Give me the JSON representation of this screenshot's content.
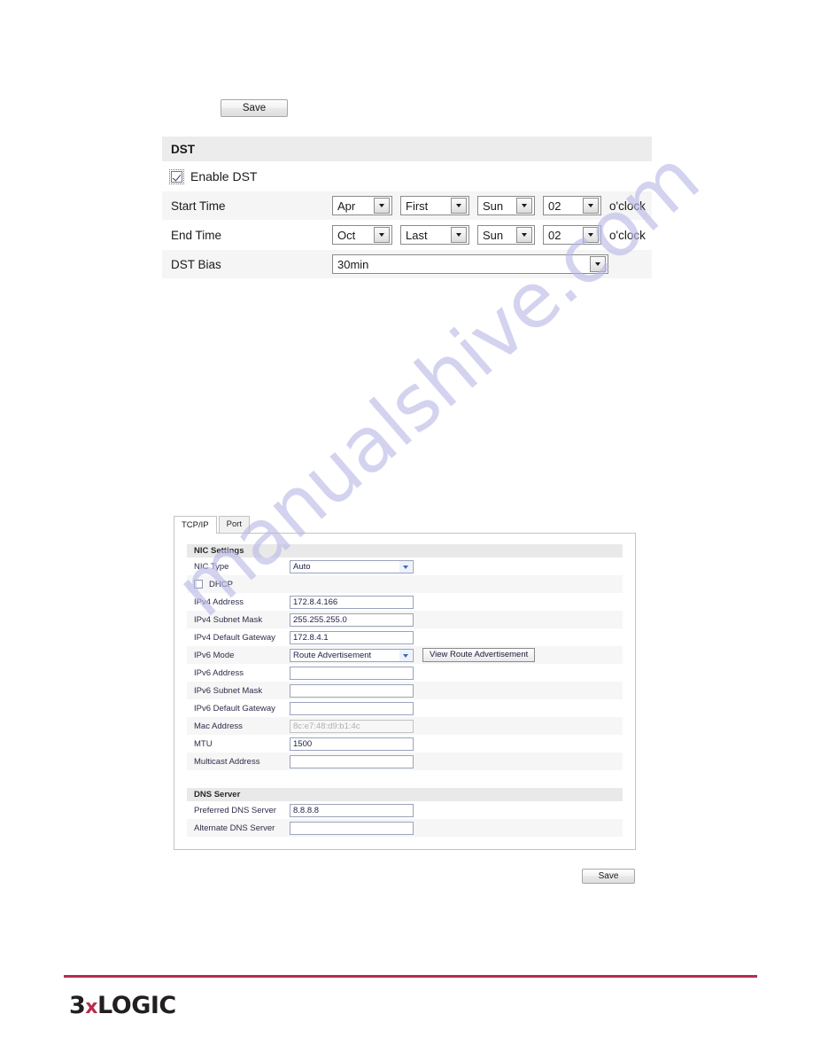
{
  "watermark": {
    "text": "manualshive.com",
    "color": "#b9b9e8"
  },
  "top_toolbar": {
    "save_label": "Save"
  },
  "dst": {
    "header": "DST",
    "enable": {
      "label": "Enable DST",
      "checked": true
    },
    "start_time": {
      "label": "Start Time",
      "month": "Apr",
      "week": "First",
      "day": "Sun",
      "hour": "02",
      "suffix": "o'clock"
    },
    "end_time": {
      "label": "End Time",
      "month": "Oct",
      "week": "Last",
      "day": "Sun",
      "hour": "02",
      "suffix": "o'clock"
    },
    "bias": {
      "label": "DST Bias",
      "value": "30min"
    }
  },
  "tcpip_panel": {
    "tabs": [
      {
        "label": "TCP/IP",
        "active": true
      },
      {
        "label": "Port",
        "active": false
      }
    ],
    "nic_settings": {
      "header": "NIC Settings",
      "nic_type": {
        "label": "NIC Type",
        "value": "Auto"
      },
      "dhcp": {
        "label": "DHCP",
        "checked": false
      },
      "ipv4_address": {
        "label": "IPv4 Address",
        "value": "172.8.4.166"
      },
      "ipv4_subnet_mask": {
        "label": "IPv4 Subnet Mask",
        "value": "255.255.255.0"
      },
      "ipv4_default_gateway": {
        "label": "IPv4 Default Gateway",
        "value": "172.8.4.1"
      },
      "ipv6_mode": {
        "label": "IPv6 Mode",
        "value": "Route Advertisement",
        "button": "View Route Advertisement"
      },
      "ipv6_address": {
        "label": "IPv6 Address",
        "value": ""
      },
      "ipv6_subnet_mask": {
        "label": "IPv6 Subnet Mask",
        "value": ""
      },
      "ipv6_default_gateway": {
        "label": "IPv6 Default Gateway",
        "value": ""
      },
      "mac_address": {
        "label": "Mac Address",
        "value": "8c:e7:48:d9:b1:4c",
        "disabled": true
      },
      "mtu": {
        "label": "MTU",
        "value": "1500"
      },
      "multicast_address": {
        "label": "Multicast Address",
        "value": ""
      }
    },
    "dns_server": {
      "header": "DNS Server",
      "preferred": {
        "label": "Preferred DNS Server",
        "value": "8.8.8.8"
      },
      "alternate": {
        "label": "Alternate DNS Server",
        "value": ""
      }
    },
    "save_label": "Save"
  },
  "footer": {
    "logo_part1": "3",
    "logo_x": "x",
    "logo_part2": "LOGIC",
    "rule_color": "#b62d51"
  }
}
